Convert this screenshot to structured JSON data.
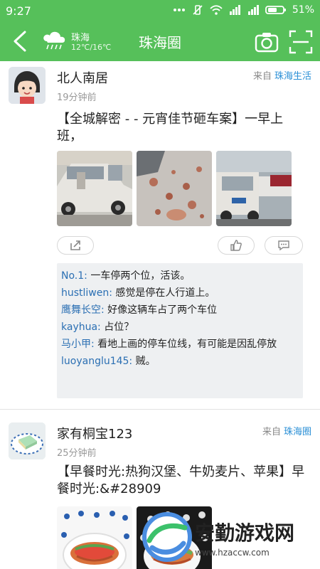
{
  "status": {
    "time": "9:27",
    "icons": [
      "more-dots-icon",
      "vibrate-off-icon",
      "wifi-icon",
      "signal-1-icon",
      "signal-2-icon",
      "battery-icon"
    ],
    "battery_percent": "51%"
  },
  "appbar": {
    "weather_city": "珠海",
    "weather_temp": "12℃/16℃",
    "title": "珠海圈"
  },
  "posts": [
    {
      "username": "北人南居",
      "time": "19分钟前",
      "source_label": "来自",
      "source_name": "珠海生活",
      "content": "【全城解密 - - 元宵佳节砸车案】一早上班，",
      "comments": [
        {
          "user": "No.1:",
          "text": " 一车停两个位，活该。"
        },
        {
          "user": "hustliwen:",
          "text": " 感觉是停在人行道上。"
        },
        {
          "user": "鹰舞长空:",
          "text": " 好像这辆车占了两个车位"
        },
        {
          "user": "kayhua:",
          "text": " 占位？"
        },
        {
          "user": "马小甲:",
          "text": " 看地上画的停车位线，有可能是因乱停放"
        },
        {
          "user": "luoyanglu145:",
          "text": " 贼。"
        }
      ]
    },
    {
      "username": "家有桐宝123",
      "time": "25分钟前",
      "source_label": "来自",
      "source_name": "珠海圈",
      "content": "【早餐时光:热狗汉堡、牛奶麦片、苹果】早餐时光:&#28909"
    }
  ],
  "watermark": {
    "text": "安勤游戏网",
    "url": "www.hzaccw.com"
  },
  "colors": {
    "accent": "#56c05a",
    "link": "#2a8fd6"
  }
}
